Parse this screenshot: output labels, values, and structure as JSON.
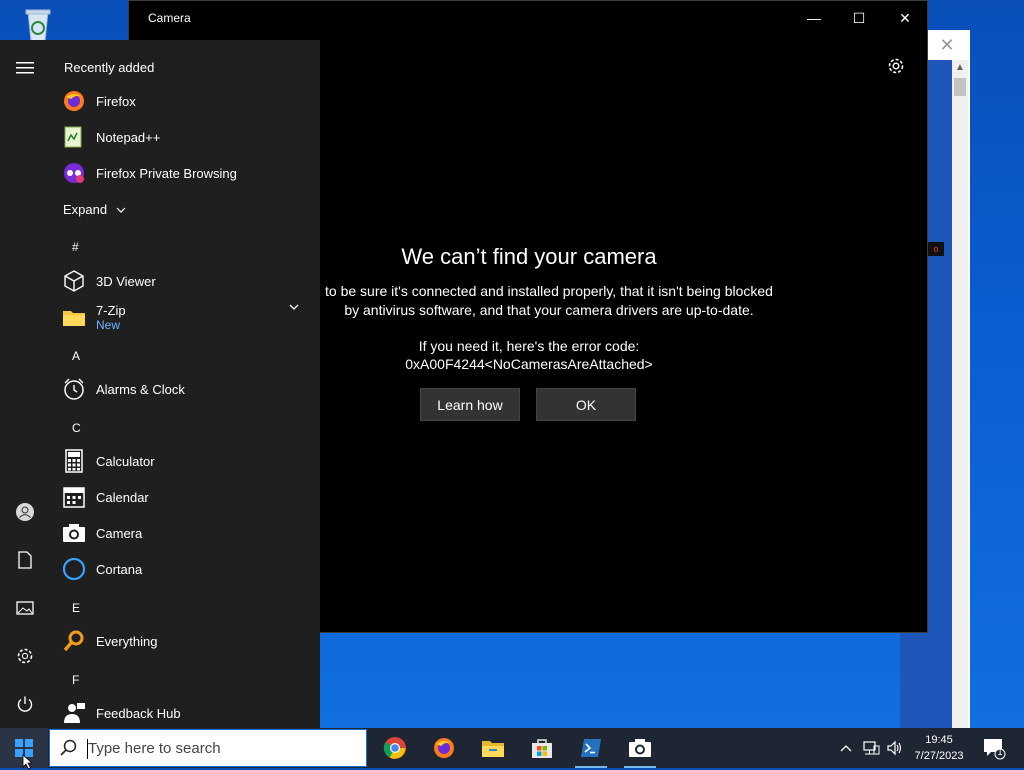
{
  "desktop": {
    "recycle_bin_icon": "recycle-bin-icon"
  },
  "background_window": {
    "close_glyph": "✕",
    "scroll_up_glyph": "▲",
    "badge_text": "o"
  },
  "camera_window": {
    "title": "Camera",
    "minimize_glyph": "—",
    "maximize_glyph": "☐",
    "close_glyph": "✕",
    "settings_icon": "gear-icon",
    "error": {
      "headline": "We can’t find your camera",
      "message_line1": "to be sure it's connected and installed properly, that it isn't being blocked",
      "message_line2": "by antivirus software, and that your camera drivers are up-to-date.",
      "code_label": "If you need it, here's the error code:",
      "code_value": "0xA00F4244<NoCamerasAreAttached>"
    },
    "buttons": {
      "learn_how": "Learn how",
      "ok": "OK"
    }
  },
  "start_menu": {
    "rail": [
      "hamburger-icon",
      "user-icon",
      "document-icon",
      "pictures-icon",
      "settings-icon",
      "power-icon"
    ],
    "recently_added_label": "Recently added",
    "recent": [
      {
        "label": "Firefox",
        "icon": "firefox-icon"
      },
      {
        "label": "Notepad++",
        "icon": "notepadpp-icon"
      },
      {
        "label": "Firefox Private Browsing",
        "icon": "firefox-private-icon"
      }
    ],
    "expand_label": "Expand",
    "letters": {
      "hash": "#",
      "a": "A",
      "c": "C",
      "e": "E",
      "f": "F"
    },
    "apps": {
      "viewer3d": "3D Viewer",
      "zip": "7-Zip",
      "zip_badge": "New",
      "alarms": "Alarms & Clock",
      "calculator": "Calculator",
      "calendar": "Calendar",
      "camera": "Camera",
      "cortana": "Cortana",
      "everything": "Everything",
      "feedback": "Feedback Hub"
    }
  },
  "taskbar": {
    "search_placeholder": "Type here to search",
    "pinned": [
      "chrome-icon",
      "firefox-icon",
      "file-explorer-icon",
      "store-icon",
      "powershell-icon",
      "camera-icon"
    ],
    "clock_time": "19:45",
    "clock_date": "7/27/2023",
    "notification_count": "1"
  },
  "colors": {
    "accent": "#0b5ed3",
    "taskbar": "#1f2633",
    "start_menu": "#1f1f1f",
    "badge": "#6fb2ff"
  }
}
